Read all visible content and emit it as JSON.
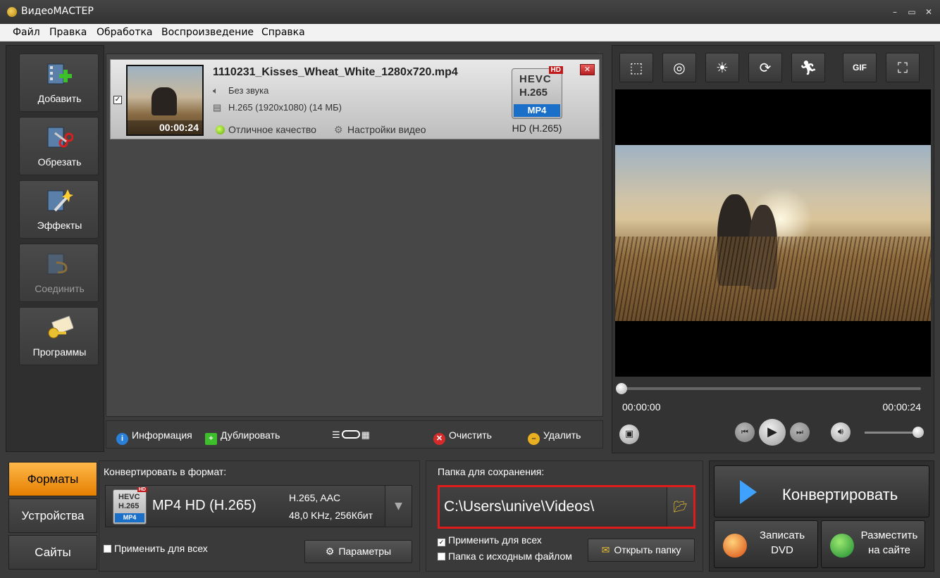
{
  "window": {
    "title": "ВидеоМАСТЕР",
    "controls": [
      "–",
      "▭",
      "✕"
    ]
  },
  "menu": [
    "Файл",
    "Правка",
    "Обработка",
    "Воспроизведение",
    "Справка"
  ],
  "sidebar": {
    "items": [
      {
        "label": "Добавить",
        "icon": "add-video-icon",
        "enabled": true
      },
      {
        "label": "Обрезать",
        "icon": "cut-icon",
        "enabled": true
      },
      {
        "label": "Эффекты",
        "icon": "effects-wand-icon",
        "enabled": true
      },
      {
        "label": "Соединить",
        "icon": "join-icon",
        "enabled": false
      },
      {
        "label": "Программы",
        "icon": "programs-icon",
        "enabled": true
      }
    ]
  },
  "file": {
    "checked": "✓",
    "name": "1110231_Kisses_Wheat_White_1280x720.mp4",
    "duration": "00:00:24",
    "audio": "Без звука",
    "video": "H.265 (1920x1080) (14 МБ)",
    "quality": "Отличное качество",
    "settings": "Настройки видео",
    "badge": {
      "line1": "HEVC",
      "line2": "H.265",
      "container": "MP4",
      "hd": "HD"
    },
    "format_label": "HD (H.265)",
    "close": "✕"
  },
  "listbar": {
    "info": "Информация",
    "duplicate": "Дублировать",
    "clear": "Очистить",
    "delete": "Удалить"
  },
  "preview": {
    "tools": [
      "crop-icon",
      "watermark-icon",
      "brightness-icon",
      "rotate-icon",
      "speed-icon",
      "gif-icon",
      "fullscreen-icon"
    ],
    "gif_label": "GIF",
    "time_start": "00:00:00",
    "time_end": "00:00:24",
    "progress": 0,
    "volume": 1
  },
  "tabs": [
    {
      "label": "Форматы",
      "active": true
    },
    {
      "label": "Устройства",
      "active": false
    },
    {
      "label": "Сайты",
      "active": false
    }
  ],
  "format": {
    "title": "Конвертировать в формат:",
    "name": "MP4 HD (H.265)",
    "codecs": "H.265, AAC",
    "audio": "48,0 KHz, 256Кбит",
    "badge": {
      "line1": "HEVC",
      "line2": "H.265",
      "container": "MP4",
      "hd": "HD"
    },
    "apply_all": "Применить для всех",
    "params_button": "Параметры"
  },
  "save": {
    "title": "Папка для сохранения:",
    "path": "C:\\Users\\unive\\Videos\\",
    "apply_all": "Применить для всех",
    "source_folder": "Папка с исходным файлом",
    "open_folder": "Открыть папку",
    "apply_all_checked": "✓",
    "source_folder_checked": ""
  },
  "convert": {
    "main": "Конвертировать",
    "dvd_line1": "Записать",
    "dvd_line2": "DVD",
    "web_line1": "Разместить",
    "web_line2": "на сайте"
  }
}
